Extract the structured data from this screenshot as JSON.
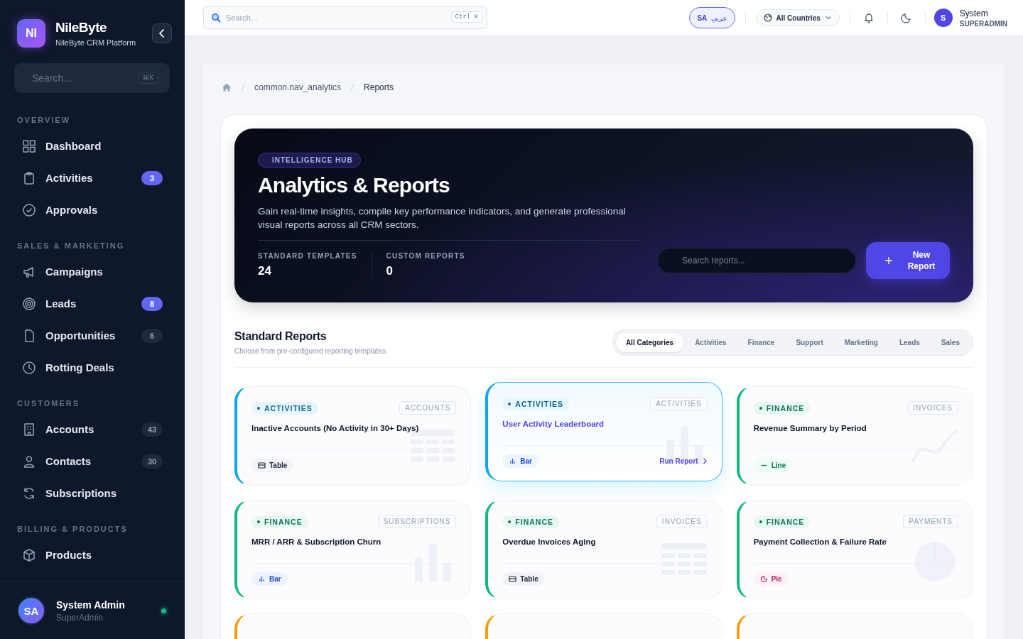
{
  "sidebar": {
    "brand": {
      "logo": "NI",
      "name": "NileByte",
      "subtitle": "NileByte CRM Platform"
    },
    "search": {
      "placeholder": "Search...",
      "shortcut": "⌘K"
    },
    "sections": [
      {
        "title": "OVERVIEW",
        "items": [
          {
            "label": "Dashboard"
          },
          {
            "label": "Activities",
            "badge": {
              "text": "3",
              "highlighted": true
            }
          },
          {
            "label": "Approvals"
          }
        ]
      },
      {
        "title": "SALES & MARKETING",
        "items": [
          {
            "label": "Campaigns"
          },
          {
            "label": "Leads",
            "badge": {
              "text": "8",
              "highlighted": true
            }
          },
          {
            "label": "Opportunities",
            "badge": {
              "text": "6",
              "highlighted": false
            }
          },
          {
            "label": "Rotting Deals"
          }
        ]
      },
      {
        "title": "CUSTOMERS",
        "items": [
          {
            "label": "Accounts",
            "badge": {
              "text": "43",
              "highlighted": false
            }
          },
          {
            "label": "Contacts",
            "badge": {
              "text": "30",
              "highlighted": false
            }
          },
          {
            "label": "Subscriptions"
          }
        ]
      },
      {
        "title": "BILLING & PRODUCTS",
        "items": [
          {
            "label": "Products"
          }
        ]
      }
    ],
    "user": {
      "initials": "SA",
      "name": "System Admin",
      "role": "SuperAdmin",
      "online": true
    }
  },
  "topbar": {
    "search": {
      "placeholder": "Search...",
      "shortcut": "Ctrl K"
    },
    "language": {
      "code": "SA",
      "label": "عربي"
    },
    "country": "All Countries",
    "user": {
      "initial": "S",
      "name": "System",
      "role": "SUPERADMIN"
    }
  },
  "breadcrumb": [
    "common.nav_analytics",
    "Reports"
  ],
  "hero": {
    "badge": "INTELLIGENCE HUB",
    "title": "Analytics & Reports",
    "description": "Gain real-time insights, compile key performance indicators, and generate professional visual reports across all CRM sectors.",
    "stats": [
      {
        "label": "STANDARD TEMPLATES",
        "value": "24"
      },
      {
        "label": "CUSTOM REPORTS",
        "value": "0"
      }
    ],
    "search": {
      "placeholder": "Search reports..."
    },
    "button": "New Report"
  },
  "standard_reports": {
    "title": "Standard Reports",
    "subtitle": "Choose from pre-configured reporting templates.",
    "filters": [
      {
        "label": "All Categories",
        "selected": true
      },
      {
        "label": "Activities",
        "selected": false
      },
      {
        "label": "Finance",
        "selected": false
      },
      {
        "label": "Support",
        "selected": false
      },
      {
        "label": "Marketing",
        "selected": false
      },
      {
        "label": "Leads",
        "selected": false
      },
      {
        "label": "Sales",
        "selected": false
      }
    ],
    "cards": [
      {
        "category": "ACTIVITIES",
        "color": "#0ea5e9",
        "entity": "ACCOUNTS",
        "title": "Inactive Accounts (No Activity in 30+ Days)",
        "kind": "table",
        "chart": "Table",
        "selected": false
      },
      {
        "category": "ACTIVITIES",
        "color": "#0ea5e9",
        "entity": "ACTIVITIES",
        "title": "User Activity Leaderboard",
        "kind": "bar",
        "chart": "Bar",
        "selected": true,
        "action": "Run Report"
      },
      {
        "category": "FINANCE",
        "color": "#10b981",
        "entity": "INVOICES",
        "title": "Revenue Summary by Period",
        "kind": "line",
        "chart": "Line",
        "selected": false
      },
      {
        "category": "FINANCE",
        "color": "#10b981",
        "entity": "SUBSCRIPTIONS",
        "title": "MRR / ARR & Subscription Churn",
        "kind": "bar",
        "chart": "Bar",
        "selected": false
      },
      {
        "category": "FINANCE",
        "color": "#10b981",
        "entity": "INVOICES",
        "title": "Overdue Invoices Aging",
        "kind": "table",
        "chart": "Table",
        "selected": false
      },
      {
        "category": "FINANCE",
        "color": "#10b981",
        "entity": "PAYMENTS",
        "title": "Payment Collection & Failure Rate",
        "kind": "pie",
        "chart": "Pie",
        "selected": false
      }
    ],
    "cut_off_cards": [
      {
        "color": "#f59e0b"
      },
      {
        "color": "#f59e0b"
      },
      {
        "color": "#f59e0b"
      }
    ]
  }
}
